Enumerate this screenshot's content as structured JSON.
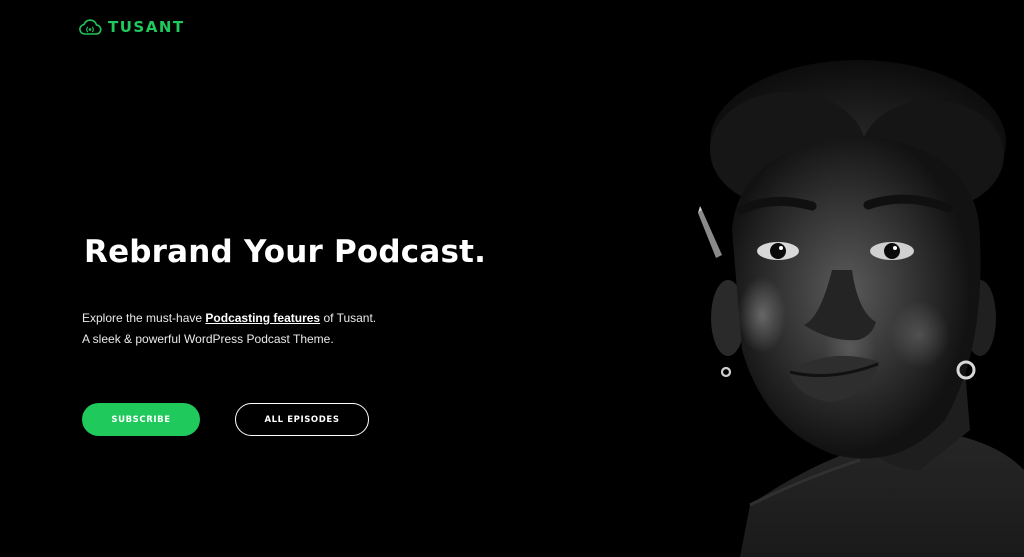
{
  "brand": {
    "name": "TUSANT",
    "logo_icon": "cloud-podcast-icon",
    "color": "#1fc95b"
  },
  "hero": {
    "headline": "Rebrand Your Podcast.",
    "line1_prefix": "Explore the must-have ",
    "line1_link": "Podcasting features",
    "line1_suffix": " of Tusant.",
    "line2": "A sleek & powerful WordPress Podcast Theme."
  },
  "buttons": {
    "subscribe": "SUBSCRIBE",
    "all_episodes": "ALL EPISODES"
  },
  "colors": {
    "background": "#000000",
    "accent": "#1fc95b",
    "text": "#ffffff"
  }
}
